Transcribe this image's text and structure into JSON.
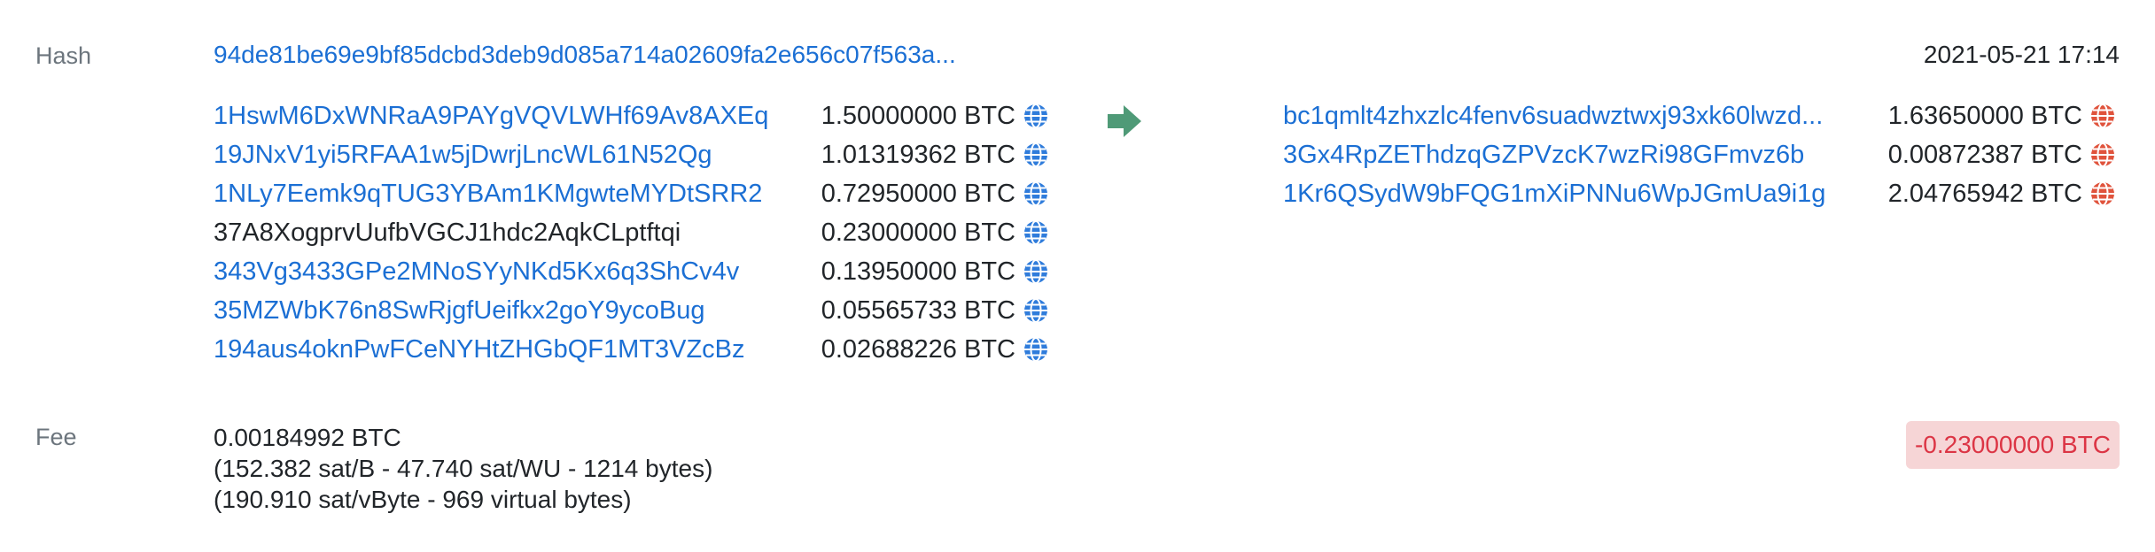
{
  "labels": {
    "hash": "Hash",
    "fee": "Fee"
  },
  "tx": {
    "hash": "94de81be69e9bf85dcbd3deb9d085a714a02609fa2e656c07f563a...",
    "timestamp": "2021-05-21 17:14"
  },
  "inputs": [
    {
      "address": "1HswM6DxWNRaA9PAYgVQVLWHf69Av8AXEq",
      "amount": "1.50000000 BTC",
      "link": true
    },
    {
      "address": "19JNxV1yi5RFAA1w5jDwrjLncWL61N52Qg",
      "amount": "1.01319362 BTC",
      "link": true
    },
    {
      "address": "1NLy7Eemk9qTUG3YBAm1KMgwteMYDtSRR2",
      "amount": "0.72950000 BTC",
      "link": true
    },
    {
      "address": "37A8XogprvUufbVGCJ1hdc2AqkCLptftqi",
      "amount": "0.23000000 BTC",
      "link": false
    },
    {
      "address": "343Vg3433GPe2MNoSYyNKd5Kx6q3ShCv4v",
      "amount": "0.13950000 BTC",
      "link": true
    },
    {
      "address": "35MZWbK76n8SwRjgfUeifkx2goY9ycoBug",
      "amount": "0.05565733 BTC",
      "link": true
    },
    {
      "address": "194aus4oknPwFCeNYHtZHGbQF1MT3VZcBz",
      "amount": "0.02688226 BTC",
      "link": true
    }
  ],
  "outputs": [
    {
      "address": "bc1qmlt4zhxzlc4fenv6suadwztwxj93xk60lwzd...",
      "amount": "1.63650000 BTC"
    },
    {
      "address": "3Gx4RpZEThdzqGZPVzcK7wzRi98GFmvz6b",
      "amount": "0.00872387 BTC"
    },
    {
      "address": "1Kr6QSydW9bFQG1mXiPNNu6WpJGmUa9i1g",
      "amount": "2.04765942 BTC"
    }
  ],
  "fee": {
    "btc": "0.00184992 BTC",
    "rate_line1": "(152.382 sat/B - 47.740 sat/WU - 1214 bytes)",
    "rate_line2": "(190.910 sat/vByte - 969 virtual bytes)"
  },
  "balance_change": "-0.23000000 BTC",
  "icons": {
    "input": "globe-icon",
    "output": "globe-icon",
    "arrow": "arrow-right-icon"
  },
  "colors": {
    "link": "#1b6fd4",
    "input_icon": "#2f7cdb",
    "output_icon": "#e0533c",
    "arrow": "#4f9a77",
    "badge_bg": "#f6d5d6",
    "badge_text": "#dc3545"
  }
}
